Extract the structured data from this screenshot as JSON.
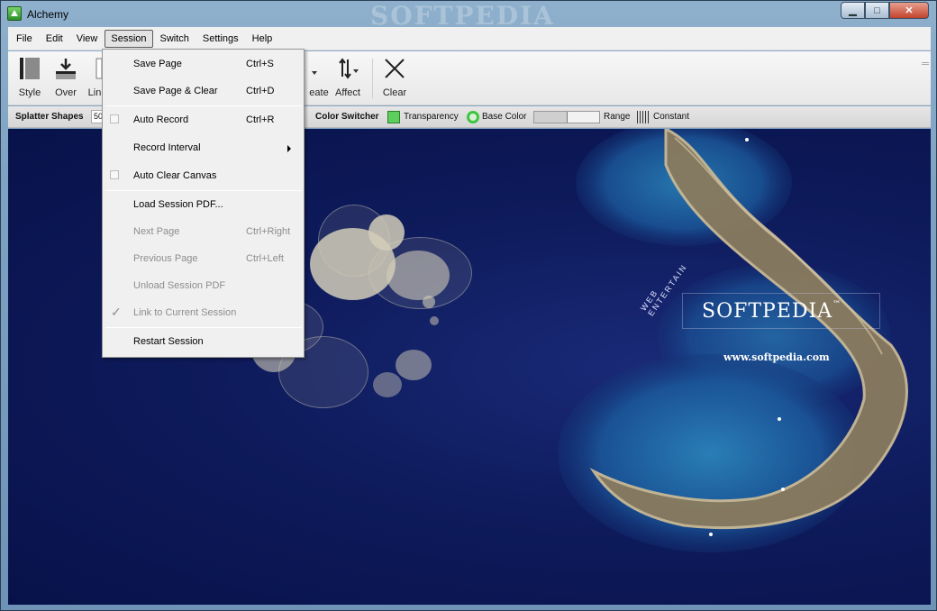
{
  "window": {
    "title": "Alchemy",
    "watermark": "SOFTPEDIA"
  },
  "menubar": [
    "File",
    "Edit",
    "View",
    "Session",
    "Switch",
    "Settings",
    "Help"
  ],
  "toolbar": {
    "style": "Style",
    "over": "Over",
    "line": "Lin",
    "create": "eate",
    "affect": "Affect",
    "clear": "Clear"
  },
  "subbar": {
    "splatter": "Splatter Shapes",
    "splatter_value": "50",
    "color_switcher": "Color Switcher",
    "transparency": "Transparency",
    "base_color": "Base Color",
    "range": "Range",
    "constant": "Constant"
  },
  "session_menu": {
    "save_page": {
      "label": "Save Page",
      "shortcut": "Ctrl+S"
    },
    "save_clear": {
      "label": "Save Page & Clear",
      "shortcut": "Ctrl+D"
    },
    "auto_record": {
      "label": "Auto Record",
      "shortcut": "Ctrl+R"
    },
    "record_interval": {
      "label": "Record Interval"
    },
    "auto_clear": {
      "label": "Auto Clear Canvas"
    },
    "load_pdf": {
      "label": "Load Session PDF..."
    },
    "next_page": {
      "label": "Next Page",
      "shortcut": "Ctrl+Right"
    },
    "prev_page": {
      "label": "Previous Page",
      "shortcut": "Ctrl+Left"
    },
    "unload_pdf": {
      "label": "Unload Session PDF"
    },
    "link_session": {
      "label": "Link to Current Session"
    },
    "restart": {
      "label": "Restart Session"
    }
  },
  "canvas": {
    "brand": "SOFTPEDIA",
    "tm": "™",
    "url": "www.softpedia.com",
    "arc_text": "WEB ENTERTAIN"
  },
  "colors": {
    "accent_green": "#5ccf5c",
    "canvas_bg": "#0e1b5c"
  }
}
